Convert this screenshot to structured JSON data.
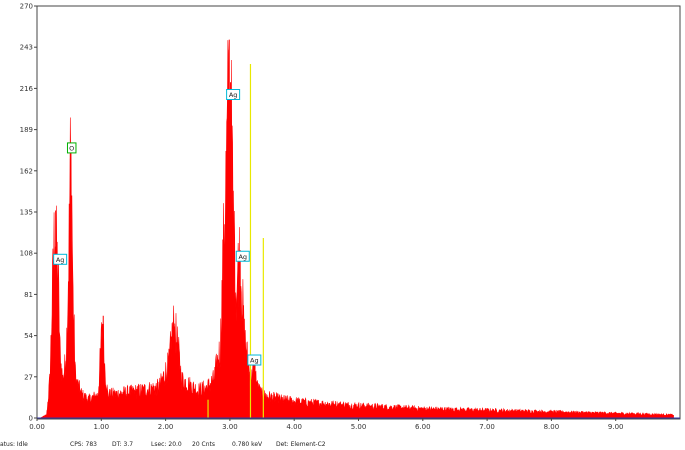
{
  "chart_data": {
    "type": "area",
    "xlabel": "",
    "ylabel": "",
    "xlim": [
      0.0,
      10.0
    ],
    "ylim": [
      0,
      270
    ],
    "x_ticks": [
      "0.00",
      "1.00",
      "2.00",
      "3.00",
      "4.00",
      "5.00",
      "6.00",
      "7.00",
      "8.00",
      "9.00"
    ],
    "y_ticks": [
      "0",
      "27",
      "54",
      "81",
      "108",
      "135",
      "162",
      "189",
      "216",
      "243",
      "270"
    ],
    "grid": false,
    "spectrum_color": "#ff0000",
    "spectrum_profile": [
      [
        0.05,
        0
      ],
      [
        0.15,
        2
      ],
      [
        0.2,
        25
      ],
      [
        0.25,
        95
      ],
      [
        0.28,
        130
      ],
      [
        0.3,
        110
      ],
      [
        0.33,
        90
      ],
      [
        0.36,
        40
      ],
      [
        0.4,
        25
      ],
      [
        0.44,
        35
      ],
      [
        0.47,
        60
      ],
      [
        0.5,
        120
      ],
      [
        0.52,
        168
      ],
      [
        0.54,
        150
      ],
      [
        0.56,
        80
      ],
      [
        0.6,
        25
      ],
      [
        0.7,
        15
      ],
      [
        0.8,
        12
      ],
      [
        0.95,
        15
      ],
      [
        1.0,
        50
      ],
      [
        1.02,
        65
      ],
      [
        1.05,
        35
      ],
      [
        1.1,
        15
      ],
      [
        1.5,
        17
      ],
      [
        1.9,
        20
      ],
      [
        2.05,
        35
      ],
      [
        2.12,
        60
      ],
      [
        2.18,
        50
      ],
      [
        2.25,
        25
      ],
      [
        2.5,
        18
      ],
      [
        2.65,
        20
      ],
      [
        2.75,
        25
      ],
      [
        2.85,
        45
      ],
      [
        2.9,
        110
      ],
      [
        2.95,
        170
      ],
      [
        2.98,
        215
      ],
      [
        3.02,
        190
      ],
      [
        3.06,
        120
      ],
      [
        3.1,
        80
      ],
      [
        3.12,
        95
      ],
      [
        3.15,
        105
      ],
      [
        3.18,
        90
      ],
      [
        3.22,
        55
      ],
      [
        3.27,
        40
      ],
      [
        3.32,
        25
      ],
      [
        3.38,
        32
      ],
      [
        3.43,
        20
      ],
      [
        3.5,
        15
      ],
      [
        3.8,
        12
      ],
      [
        4.2,
        10
      ],
      [
        5.0,
        8
      ],
      [
        6.0,
        6
      ],
      [
        7.0,
        5
      ],
      [
        8.0,
        4
      ],
      [
        9.0,
        3
      ],
      [
        9.9,
        2
      ]
    ],
    "spikes": [
      {
        "x": 0.29,
        "y": 136
      },
      {
        "x": 0.52,
        "y": 170
      },
      {
        "x": 1.03,
        "y": 67
      },
      {
        "x": 2.13,
        "y": 60
      },
      {
        "x": 2.99,
        "y": 248
      },
      {
        "x": 3.01,
        "y": 220
      },
      {
        "x": 3.16,
        "y": 110
      },
      {
        "x": 3.39,
        "y": 38
      }
    ],
    "marker_color": "#e8e800",
    "markers": [
      {
        "x": 2.66,
        "y": 12
      },
      {
        "x": 3.32,
        "y": 232
      },
      {
        "x": 3.52,
        "y": 118
      }
    ],
    "peak_labels": [
      {
        "text": "O",
        "x": 0.54,
        "y": 177,
        "border": "#00b000"
      },
      {
        "text": "Ag",
        "x": 0.36,
        "y": 104,
        "border": "#00b8d8"
      },
      {
        "text": "Ag",
        "x": 3.05,
        "y": 212,
        "border": "#00b8d8"
      },
      {
        "text": "Ag",
        "x": 3.2,
        "y": 106,
        "border": "#00b8d8"
      },
      {
        "text": "Ag",
        "x": 3.38,
        "y": 38,
        "border": "#00b8d8"
      }
    ]
  },
  "status_bar": {
    "status": "atus: Idle",
    "cps": "CPS: 783",
    "dt": "DT: 3.7",
    "lsec": "Lsec: 20.0",
    "cnts": "20 Cnts",
    "kev": "0.780 keV",
    "det": "Det: Element-C2"
  }
}
